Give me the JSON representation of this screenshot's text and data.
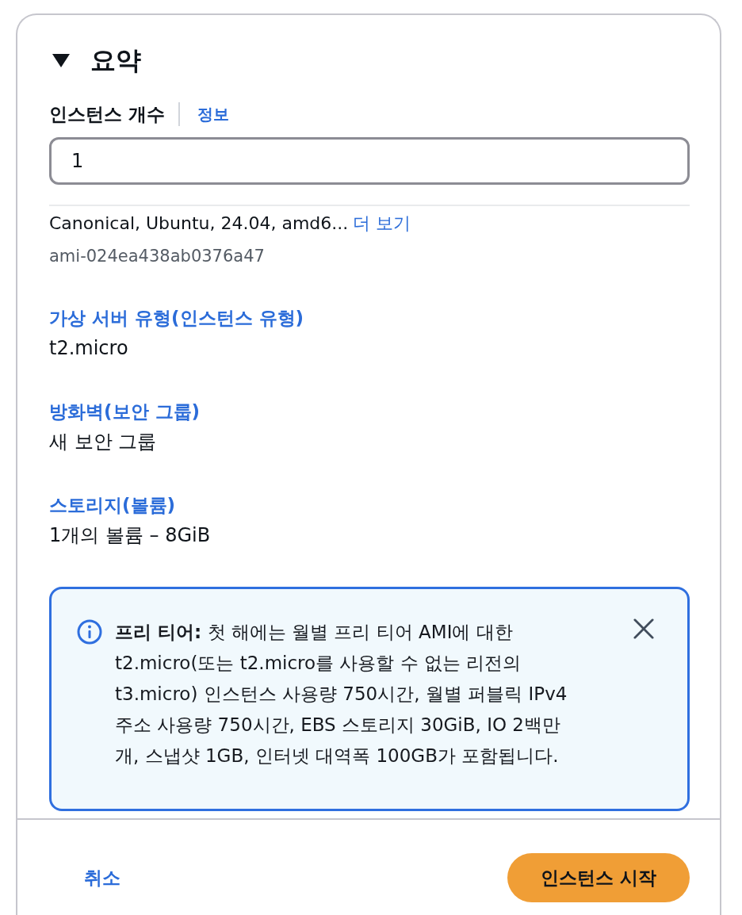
{
  "section": {
    "title": "요약",
    "expanded": true
  },
  "instance_count": {
    "label": "인스턴스 개수",
    "info_link": "정보",
    "value": "1"
  },
  "summary_items": [
    {
      "kind": "ami",
      "description": "Canonical, Ubuntu, 24.04, amd6...",
      "more_link": "더 보기",
      "value": "ami-024ea438ab0376a47"
    },
    {
      "kind": "field",
      "label": "가상 서버 유형(인스턴스 유형)",
      "value": "t2.micro"
    },
    {
      "kind": "field",
      "label": "방화벽(보안 그룹)",
      "value": "새 보안 그룹"
    },
    {
      "kind": "field",
      "label": "스토리지(볼륨)",
      "value": "1개의 볼륨 – 8GiB"
    }
  ],
  "alert": {
    "kind": "info",
    "dismissible": true,
    "text": "**프리 티어:** 첫 해에는 월별 프리 티어 AMI에 대한 t2.micro(또는 t2.micro를 사용할 수 없는 리전의 t3.micro) 인스턴스 사용량 750시간, 월별 퍼블릭 IPv4 주소 사용량 750시간, EBS 스토리지 30GiB, IO 2백만 개, 스냅샷 1GB, 인터넷 대역폭 100GB가 포함됩니다."
  },
  "footer": {
    "cancel": "취소",
    "primary": "인스턴스 시작"
  }
}
